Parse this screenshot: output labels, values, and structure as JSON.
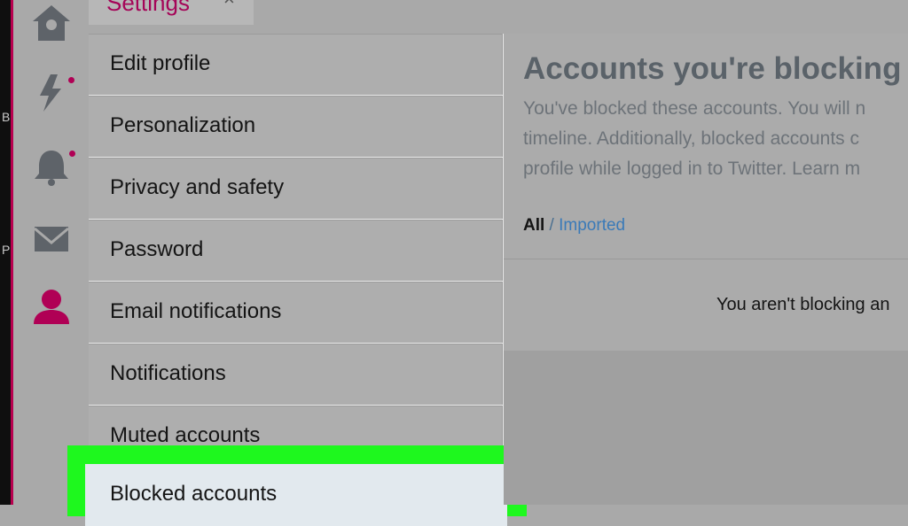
{
  "window": {
    "left_edge_chars": [
      "B",
      "P"
    ]
  },
  "tab": {
    "label": "Settings",
    "close_glyph": "×"
  },
  "rail": {
    "icons": [
      "home-icon",
      "lightning-icon",
      "bell-icon",
      "mail-icon",
      "profile-icon"
    ],
    "accent_color": "#b00055"
  },
  "menu": {
    "items": [
      {
        "label": "Edit profile"
      },
      {
        "label": "Personalization"
      },
      {
        "label": "Privacy and safety"
      },
      {
        "label": "Password"
      },
      {
        "label": "Email notifications"
      },
      {
        "label": "Notifications"
      },
      {
        "label": "Muted accounts"
      },
      {
        "label": "Blocked accounts",
        "selected": true
      }
    ]
  },
  "highlight_color": "#1ef81e",
  "content": {
    "title": "Accounts you're blocking",
    "desc_lines": [
      "You've blocked these accounts. You will n",
      "timeline. Additionally, blocked accounts c",
      "profile while logged in to Twitter. Learn m"
    ],
    "filter_all": "All",
    "filter_sep": " / ",
    "filter_imported": "Imported",
    "empty_text": "You aren't blocking an"
  }
}
